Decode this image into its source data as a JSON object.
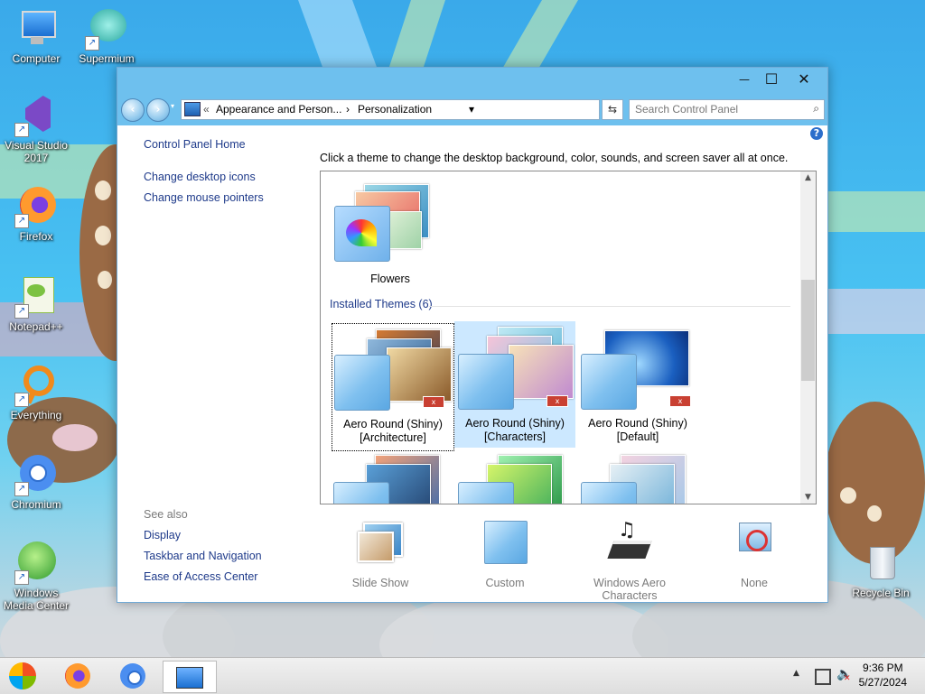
{
  "desktop_icons": [
    {
      "label": "Computer"
    },
    {
      "label": "Supermium"
    },
    {
      "label": "Visual Studio 2017"
    },
    {
      "label": "Firefox"
    },
    {
      "label": "Notepad++"
    },
    {
      "label": "Everything"
    },
    {
      "label": "Chromium"
    },
    {
      "label": "Windows Media Center"
    },
    {
      "label": "Recycle Bin"
    }
  ],
  "window": {
    "controls": {
      "minimize": "—",
      "maximize": "☐",
      "close": "✕"
    },
    "address": {
      "overflow": "«",
      "crumb1": "Appearance and Person...",
      "sep": "›",
      "crumb2": "Personalization",
      "dropdown": "▾"
    },
    "refresh_glyph": "⇆",
    "search_placeholder": "Search Control Panel",
    "sidebar": {
      "home": "Control Panel Home",
      "links": [
        "Change desktop icons",
        "Change mouse pointers"
      ],
      "see_also_title": "See also",
      "see_also": [
        "Display",
        "Taskbar and Navigation",
        "Ease of Access Center"
      ]
    },
    "intro": "Click a theme to change the desktop background, color, sounds, and screen saver all at once.",
    "my_theme": {
      "name": "Flowers"
    },
    "installed_header": "Installed Themes (6)",
    "installed_themes": [
      {
        "line1": "Aero Round (Shiny)",
        "line2": "[Architecture]"
      },
      {
        "line1": "Aero Round (Shiny)",
        "line2": "[Characters]"
      },
      {
        "line1": "Aero Round (Shiny)",
        "line2": "[Default]"
      }
    ],
    "bottom_options": [
      {
        "label": "Slide Show"
      },
      {
        "label": "Custom"
      },
      {
        "label": "Windows Aero Characters"
      },
      {
        "label": "None"
      }
    ]
  },
  "taskbar": {
    "clock_time": "9:36 PM",
    "clock_date": "5/27/2024"
  },
  "colors": {
    "link": "#1e3a8a",
    "titlebar": "#6ec0ee",
    "selection": "#cce8ff"
  }
}
